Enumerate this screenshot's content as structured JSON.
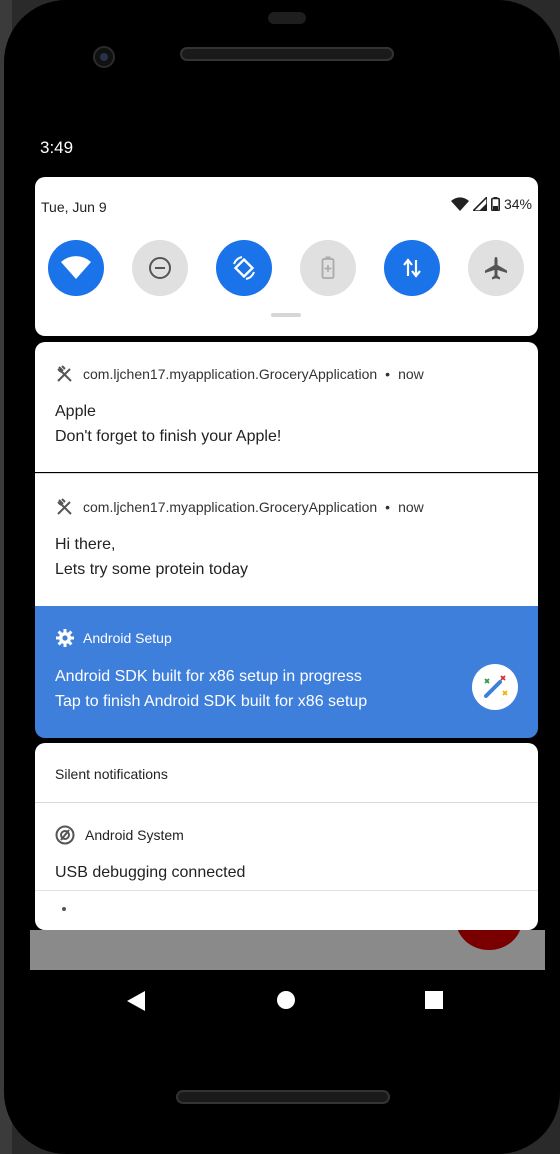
{
  "status_bar": {
    "time": "3:49"
  },
  "quick_settings": {
    "date": "Tue, Jun 9",
    "battery": "34%",
    "tiles": [
      {
        "name": "wifi",
        "state": "on",
        "icon": "wifi-icon"
      },
      {
        "name": "do-not-disturb",
        "state": "off",
        "icon": "minus-circle-icon"
      },
      {
        "name": "auto-rotate",
        "state": "on",
        "icon": "rotate-icon"
      },
      {
        "name": "battery-saver",
        "state": "off",
        "icon": "battery-icon"
      },
      {
        "name": "mobile-data",
        "state": "on",
        "icon": "data-arrows-icon"
      },
      {
        "name": "airplane-mode",
        "state": "off",
        "icon": "airplane-icon"
      }
    ]
  },
  "notifications": [
    {
      "app": "com.ljchen17.myapplication.GroceryApplication",
      "time": "now",
      "title": "Apple",
      "text": "Don't forget to finish your Apple!"
    },
    {
      "app": "com.ljchen17.myapplication.GroceryApplication",
      "time": "now",
      "title": "Hi there,",
      "text": "Lets try some protein today"
    },
    {
      "app": "Android Setup",
      "title": "Android SDK built for x86 setup in progress",
      "text": "Tap to finish Android SDK built for x86 setup",
      "accent": "#3f7fdc"
    }
  ],
  "silent": {
    "header": "Silent notifications",
    "app": "Android System",
    "text": "USB debugging connected"
  },
  "colors": {
    "accent": "#1a73e8",
    "setup_bg": "#3f7fdc"
  }
}
